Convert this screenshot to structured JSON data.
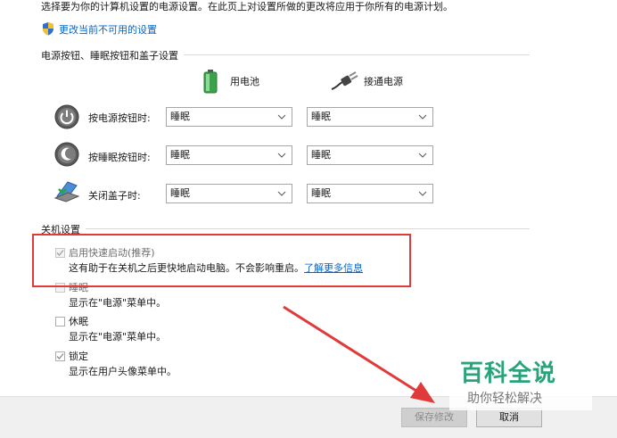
{
  "intro_text": "选择要为你的计算机设置的电源设置。在此页上对设置所做的更改将应用于你所有的电源计划。",
  "change_settings_link": "更改当前不可用的设置",
  "power_section": {
    "title": "电源按钮、睡眠按钮和盖子设置",
    "col_battery": "用电池",
    "col_plugged": "接通电源",
    "rows": [
      {
        "label": "按电源按钮时:",
        "battery": "睡眠",
        "plugged": "睡眠"
      },
      {
        "label": "按睡眠按钮时:",
        "battery": "睡眠",
        "plugged": "睡眠"
      },
      {
        "label": "关闭盖子时:",
        "battery": "睡眠",
        "plugged": "睡眠"
      }
    ]
  },
  "shutdown_section": {
    "title": "关机设置",
    "options": [
      {
        "title": "启用快速启动(推荐)",
        "desc": "这有助于在关机之后更快地启动电脑。不会影响重启。",
        "link": "了解更多信息",
        "checked": true
      },
      {
        "title": "睡眠",
        "desc": "显示在\"电源\"菜单中。",
        "checked": false
      },
      {
        "title": "休眠",
        "desc": "显示在\"电源\"菜单中。",
        "checked": false
      },
      {
        "title": "锁定",
        "desc": "显示在用户头像菜单中。",
        "checked": true
      }
    ]
  },
  "buttons": {
    "save": "保存修改",
    "cancel": "取消"
  },
  "watermark": {
    "title": "百科全说",
    "subtitle": "助你轻松解决"
  },
  "colors": {
    "link": "#0066cc",
    "highlight": "#e03a3a",
    "watermark": "#2aa37a"
  }
}
